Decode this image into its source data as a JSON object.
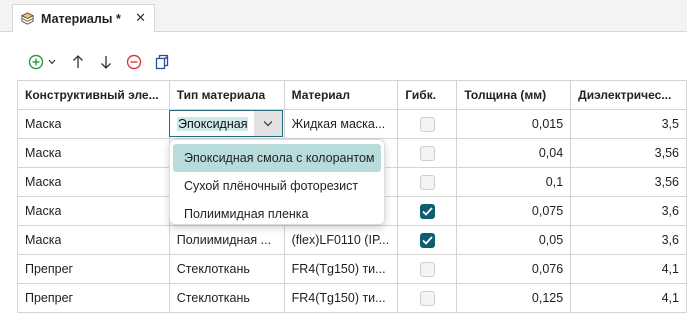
{
  "tab": {
    "title": "Материалы *",
    "icon": "materials-stack-icon",
    "close_label": "✕"
  },
  "toolbar": {
    "buttons": [
      {
        "icon": "add-circle-icon"
      },
      {
        "icon": "chevron-down-icon"
      },
      {
        "icon": "arrow-up-icon"
      },
      {
        "icon": "arrow-down-icon"
      },
      {
        "icon": "remove-circle-icon"
      },
      {
        "icon": "copy-icon"
      }
    ]
  },
  "table": {
    "headers": [
      "Конструктивный эле...",
      "Тип материала",
      "Материал",
      "Гибк.",
      "Толщина (мм)",
      "Диэлектричес..."
    ],
    "rows": [
      {
        "element": "Маска",
        "type": "Эпоксидная",
        "material": "Жидкая маска...",
        "flexible": false,
        "thickness": "0,015",
        "dielectric": "3,5"
      },
      {
        "element": "Маска",
        "type": "",
        "material": "...",
        "flexible": false,
        "thickness": "0,04",
        "dielectric": "3,56"
      },
      {
        "element": "Маска",
        "type": "",
        "material": "...",
        "flexible": false,
        "thickness": "0,1",
        "dielectric": "3,56"
      },
      {
        "element": "Маска",
        "type": "",
        "material": "",
        "flexible": true,
        "thickness": "0,075",
        "dielectric": "3,6"
      },
      {
        "element": "Маска",
        "type": "Полиимидная ...",
        "material": "(flex)LF0110 (IP...",
        "flexible": true,
        "thickness": "0,05",
        "dielectric": "3,6"
      },
      {
        "element": "Препрег",
        "type": "Стеклоткань",
        "material": "FR4(Tg150) ти...",
        "flexible": false,
        "thickness": "0,076",
        "dielectric": "4,1"
      },
      {
        "element": "Препрег",
        "type": "Стеклоткань",
        "material": "FR4(Tg150) ти...",
        "flexible": false,
        "thickness": "0,125",
        "dielectric": "4,1"
      }
    ]
  },
  "combo": {
    "value": "Эпоксидная",
    "button_icon": "chevron-down-icon"
  },
  "dropdown": {
    "options": [
      "Эпоксидная смола с колорантом",
      "Сухой плёночный фоторезист",
      "Полиимидная пленка"
    ],
    "selected_index": 0
  },
  "colors": {
    "accent": "#0f5e6f",
    "selection": "#b8dcdc",
    "combo_highlight": "#cfe9ea",
    "add_green": "#2e9a3a",
    "remove_red": "#d23c3c"
  }
}
